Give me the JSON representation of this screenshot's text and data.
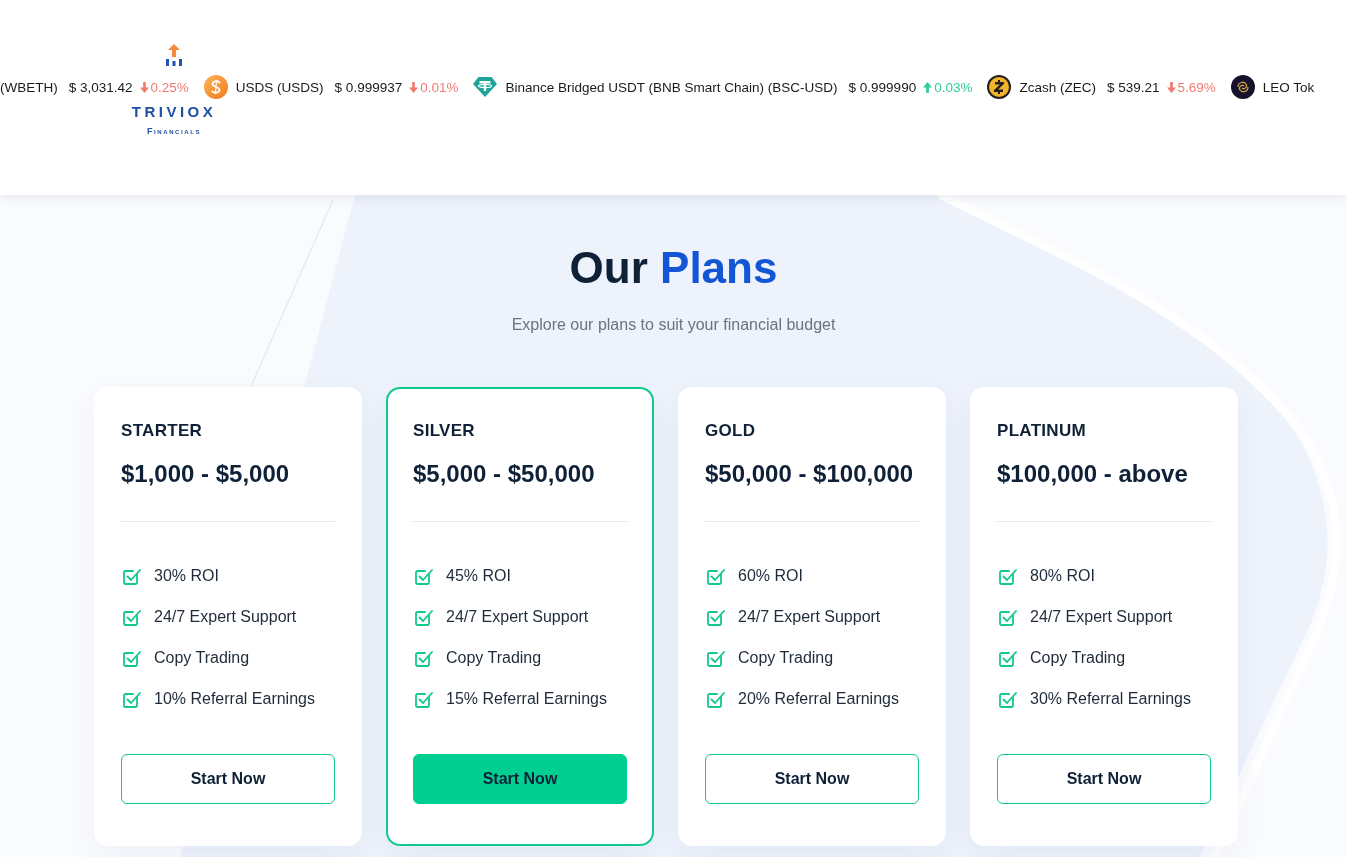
{
  "logo": {
    "name": "TRIVIOX",
    "tagline": "Financials"
  },
  "ticker": [
    {
      "name": "(WBETH)",
      "price": "$ 3,031.42",
      "rising": false,
      "change": "0.25%"
    },
    {
      "name": "USDS (USDS)",
      "price": "$ 0.999937",
      "rising": false,
      "change": "0.01%"
    },
    {
      "name": "Binance Bridged USDT (BNB Smart Chain) (BSC-USD)",
      "price": "$ 0.999990",
      "rising": true,
      "change": "0.03%"
    },
    {
      "name": "Zcash (ZEC)",
      "price": "$ 539.21",
      "rising": false,
      "change": "5.69%"
    },
    {
      "name": "LEO Tok"
    }
  ],
  "section": {
    "title": "Our",
    "title_highlight": "Plans",
    "subtitle": "Explore our plans to suit your financial budget"
  },
  "plans": [
    {
      "name": "STARTER",
      "price": "$1,000 - $5,000",
      "features": [
        "30% ROI",
        "24/7 Expert Support",
        "Copy Trading",
        "10% Referral Earnings"
      ],
      "button": "Start Now",
      "selected": false
    },
    {
      "name": "SILVER",
      "price": "$5,000 - $50,000",
      "features": [
        "45% ROI",
        "24/7 Expert Support",
        "Copy Trading",
        "15% Referral Earnings"
      ],
      "button": "Start Now",
      "selected": true
    },
    {
      "name": "GOLD",
      "price": "$50,000 - $100,000",
      "features": [
        "60% ROI",
        "24/7 Expert Support",
        "Copy Trading",
        "20% Referral Earnings"
      ],
      "button": "Start Now",
      "selected": false
    },
    {
      "name": "PLATINUM",
      "price": "$100,000 - above",
      "features": [
        "80% ROI",
        "24/7 Expert Support",
        "Copy Trading",
        "30% Referral Earnings"
      ],
      "button": "Start Now",
      "selected": false
    }
  ]
}
